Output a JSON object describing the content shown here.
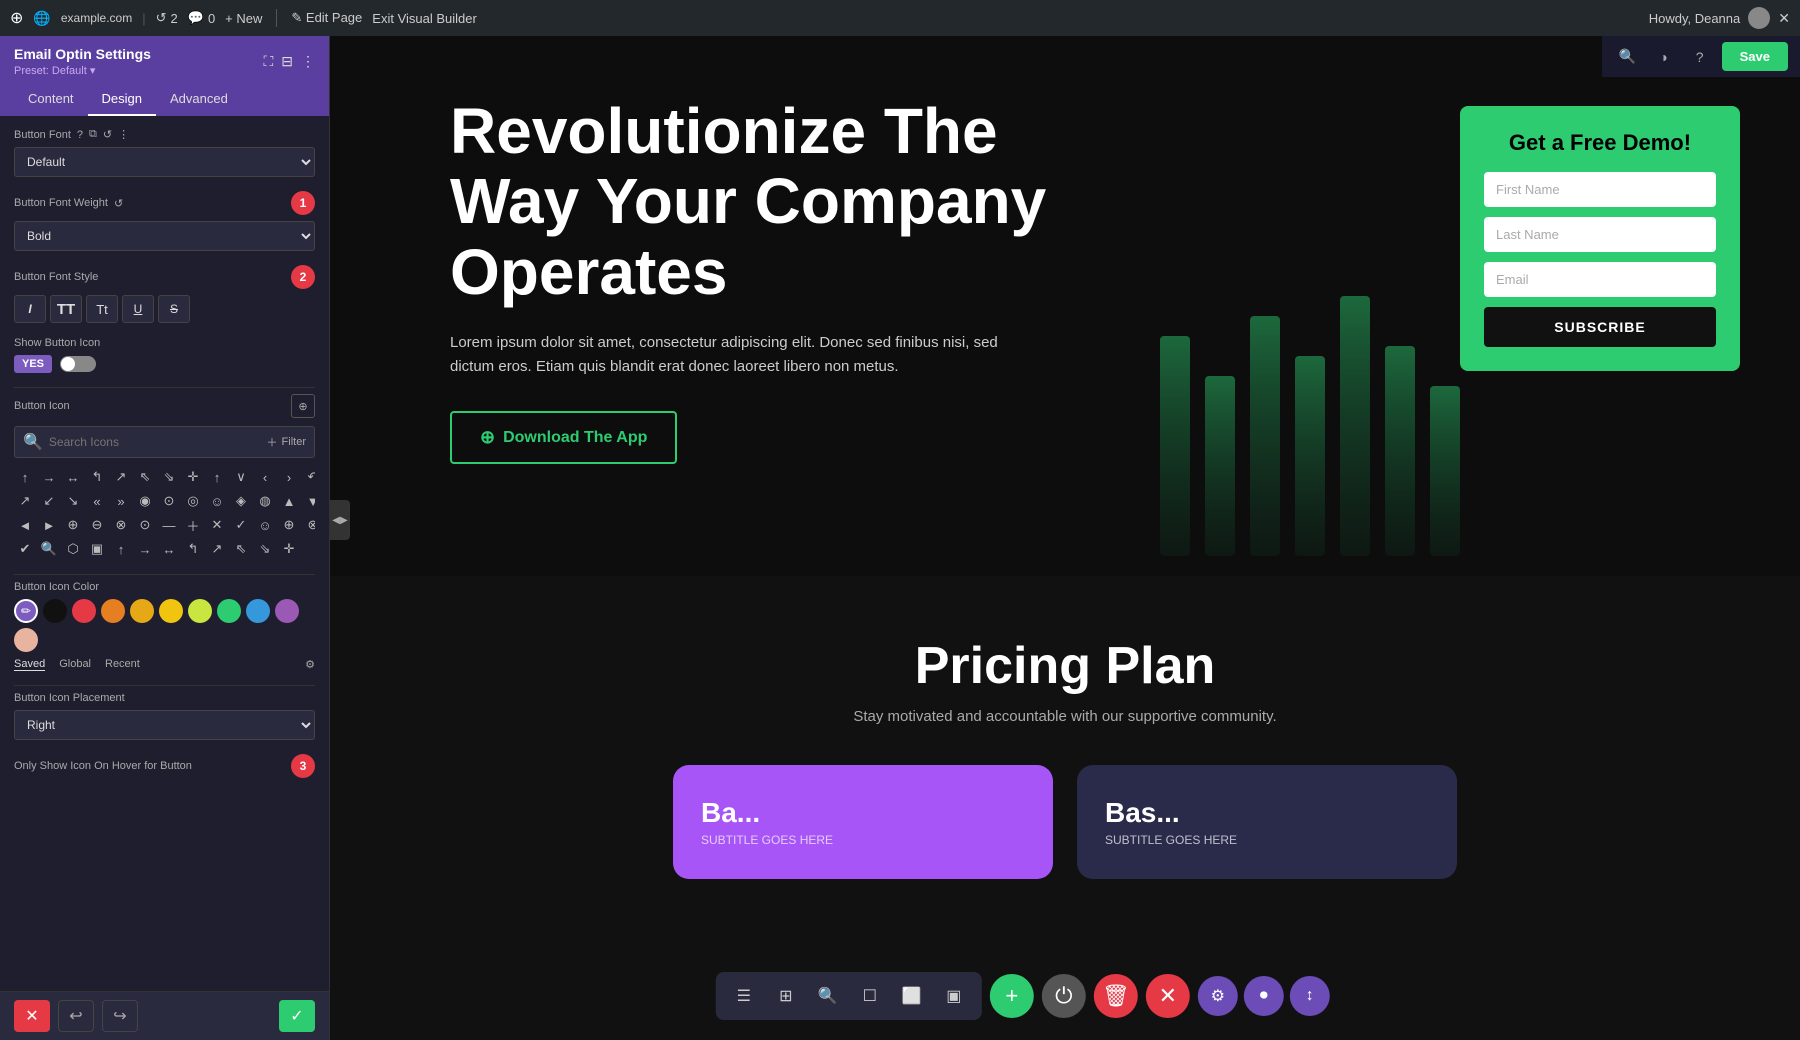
{
  "topbar": {
    "wp_logo": "⊕",
    "site_icon": "🌐",
    "site_url": "example.com",
    "updates_count": "2",
    "comments_count": "0",
    "new_label": "+ New",
    "edit_page": "✎ Edit Page",
    "exit_vb": "Exit Visual Builder",
    "howdy": "Howdy, Deanna",
    "avatar_alt": "avatar"
  },
  "panel": {
    "title": "Email Optin Settings",
    "preset": "Preset: Default ▾",
    "tabs": [
      "Content",
      "Design",
      "Advanced"
    ],
    "active_tab": "Design",
    "button_font_label": "Button Font",
    "button_font_value": "Default",
    "button_font_weight_label": "Button Font Weight",
    "button_font_weight_value": "Bold",
    "button_font_style_label": "Button Font Style",
    "font_style_buttons": [
      "I",
      "TT",
      "Tt",
      "U",
      "S"
    ],
    "show_button_icon_label": "Show Button Icon",
    "toggle_yes": "YES",
    "button_icon_label": "Button Icon",
    "icon_search_placeholder": "Search Icons",
    "filter_label": "Filter",
    "button_icon_color_label": "Button Icon Color",
    "colors": [
      {
        "name": "brush",
        "value": "brush",
        "hex": "#7c5cbf"
      },
      {
        "name": "black",
        "hex": "#111111"
      },
      {
        "name": "red",
        "hex": "#e63946"
      },
      {
        "name": "orange",
        "hex": "#e67e22"
      },
      {
        "name": "yellow",
        "hex": "#f1c40f"
      },
      {
        "name": "lime",
        "hex": "#c8e63f"
      },
      {
        "name": "green",
        "hex": "#2ecc71"
      },
      {
        "name": "blue",
        "hex": "#3498db"
      },
      {
        "name": "purple",
        "hex": "#9b59b6"
      },
      {
        "name": "pink",
        "hex": "#e8b4a0"
      }
    ],
    "color_tabs": [
      "Saved",
      "Global",
      "Recent"
    ],
    "active_color_tab": "Saved",
    "button_icon_placement_label": "Button Icon Placement",
    "button_icon_placement_value": "Right",
    "only_show_icon_label": "Only Show Icon On Hover for Button"
  },
  "hero": {
    "title": "Revolutionize The Way Your Company Operates",
    "description": "Lorem ipsum dolor sit amet, consectetur adipiscing elit. Donec sed finibus nisi, sed dictum eros. Etiam quis blandit erat donec laoreet libero non metus.",
    "btn_label": "Download The App",
    "btn_icon": "⊕"
  },
  "form_card": {
    "title": "Get a Free Demo!",
    "first_name_placeholder": "First Name",
    "last_name_placeholder": "Last Name",
    "email_placeholder": "Email",
    "subscribe_label": "SUBSCRIBE"
  },
  "pricing": {
    "title": "Pricing Plan",
    "subtitle": "Stay motivated and accountable with our supportive community.",
    "cards": [
      {
        "name": "Ba...",
        "subtitle": "SUBTITLE GOES HERE",
        "style": "purple"
      },
      {
        "name": "Bas...",
        "subtitle": "SUBTITLE GOES HERE",
        "style": "dark"
      }
    ]
  },
  "bottom_toolbar": {
    "icons": [
      "☰",
      "⊞",
      "🔍",
      "☐",
      "⬜",
      "▣"
    ],
    "fab_add": "+",
    "fab_power": "⏻",
    "fab_delete": "🗑",
    "fab_close": "✕",
    "settings_icons": [
      "⚙",
      "⏺",
      "↕"
    ]
  },
  "footer_panel": {
    "cancel_icon": "✕",
    "undo_icon": "↩",
    "redo_icon": "↪",
    "confirm_icon": "✓"
  },
  "top_right": {
    "search_icon": "🔍",
    "theme_icon": "◑",
    "help_icon": "?",
    "save_label": "Save"
  },
  "badges": {
    "b1": "1",
    "b2": "2",
    "b3": "3"
  },
  "icons_grid": [
    "↑",
    "→",
    "↔",
    "↰",
    "↗",
    "↙",
    "↘",
    "✛",
    "↑",
    "✓",
    "→",
    "↔",
    "↶",
    "↗",
    "↙",
    "↘",
    "«",
    "»",
    "◉",
    "⊙",
    "◎",
    "☺",
    "◈",
    "◉",
    "▲",
    "▼",
    "◄",
    "►",
    "⊕",
    "⊖",
    "⊗",
    "⊙",
    "—",
    "＋",
    "✕",
    "✓",
    "☺",
    "⊕",
    "⊗",
    "✓",
    "🔍",
    "🔎",
    "⬜"
  ]
}
